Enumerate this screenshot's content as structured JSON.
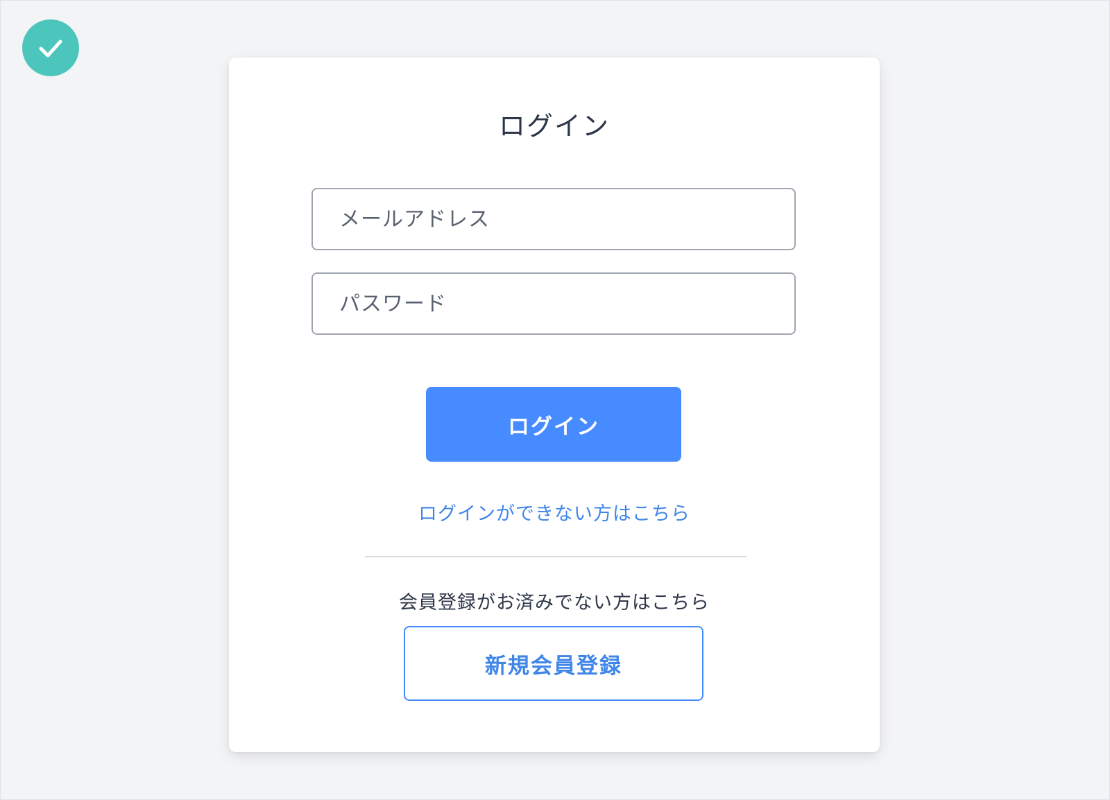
{
  "colors": {
    "page_background": "#f3f4f6",
    "badge": "#4cc6bd",
    "primary": "#468bff",
    "link": "#3f86e8",
    "register_border": "#468bff"
  },
  "badge": {
    "icon": "check-icon"
  },
  "login_form": {
    "title": "ログイン",
    "email": {
      "placeholder": "メールアドレス",
      "value": ""
    },
    "password": {
      "placeholder": "パスワード",
      "value": ""
    },
    "submit_label": "ログイン",
    "forgot_link": "ログインができない方はこちら"
  },
  "register": {
    "prompt": "会員登録がお済みでない方はこちら",
    "button_label": "新規会員登録"
  }
}
